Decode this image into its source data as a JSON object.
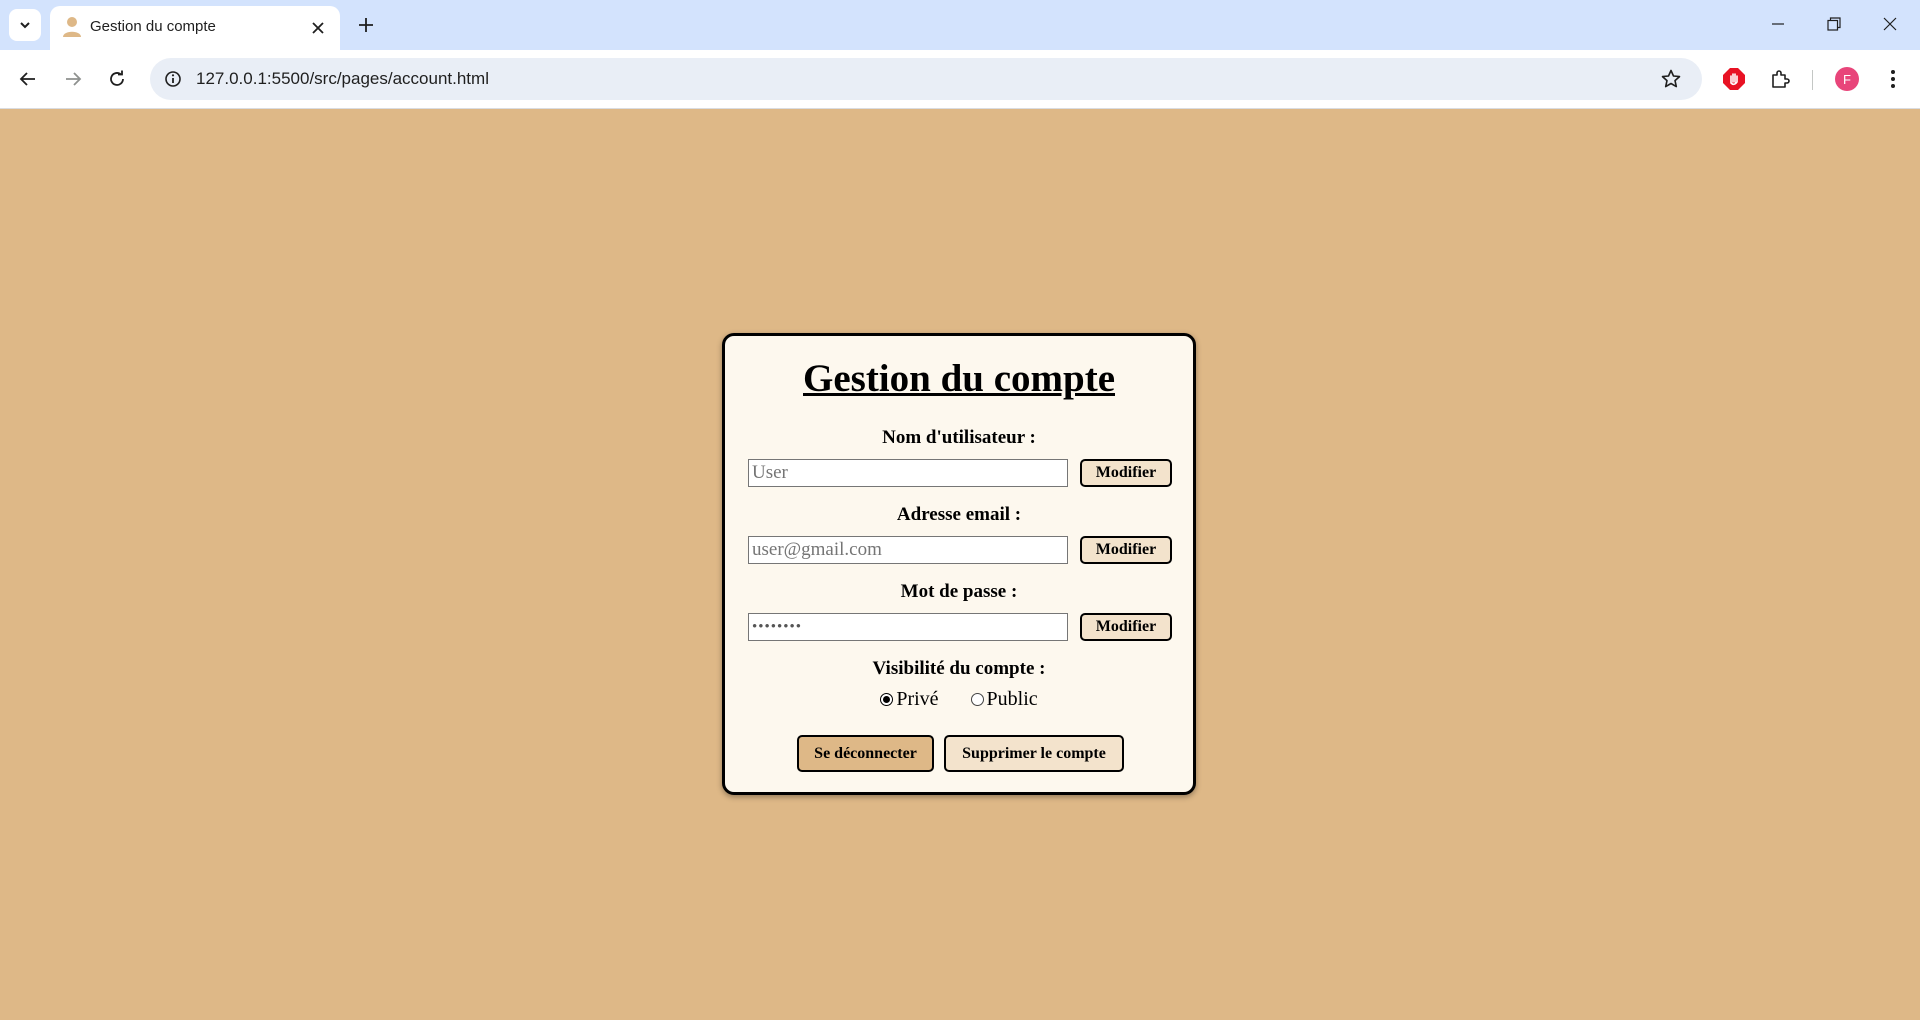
{
  "browser": {
    "tab": {
      "title": "Gestion du compte"
    },
    "url": "127.0.0.1:5500/src/pages/account.html",
    "profile_initial": "F",
    "icons": {
      "tab_search": "chevron-down-icon",
      "favicon": "user-silhouette-icon",
      "tab_close": "close-icon",
      "new_tab": "plus-icon",
      "back": "arrow-left-icon",
      "forward": "arrow-right-icon",
      "reload": "reload-icon",
      "site_info": "info-icon",
      "bookmark": "star-icon",
      "adblock": "stop-hand-icon",
      "extensions": "puzzle-icon",
      "menu": "kebab-icon",
      "minimize": "minimize-icon",
      "restore": "restore-icon",
      "close_window": "close-icon"
    },
    "colors": {
      "tabbar_bg": "#d3e3fd",
      "omnibox_bg": "#e9eef6",
      "avatar_bg": "#e8457a",
      "adblock_red": "#e81224"
    }
  },
  "page": {
    "background": "#deb887",
    "card_background": "#fdf8ee",
    "title": "Gestion du compte",
    "fields": [
      {
        "label": "Nom d'utilisateur :",
        "placeholder": "User",
        "value": "",
        "type": "text",
        "button": "Modifier"
      },
      {
        "label": "Adresse email :",
        "placeholder": "user@gmail.com",
        "value": "",
        "type": "email",
        "button": "Modifier"
      },
      {
        "label": "Mot de passe :",
        "placeholder": "",
        "value": "password",
        "type": "password",
        "button": "Modifier"
      }
    ],
    "visibility": {
      "label": "Visibilité du compte :",
      "options": [
        {
          "label": "Privé",
          "checked": true
        },
        {
          "label": "Public",
          "checked": false
        }
      ]
    },
    "actions": {
      "logout": "Se déconnecter",
      "delete": "Supprimer le compte"
    },
    "button_colors": {
      "primary": "#deb887",
      "secondary": "#f3e3cc"
    }
  }
}
